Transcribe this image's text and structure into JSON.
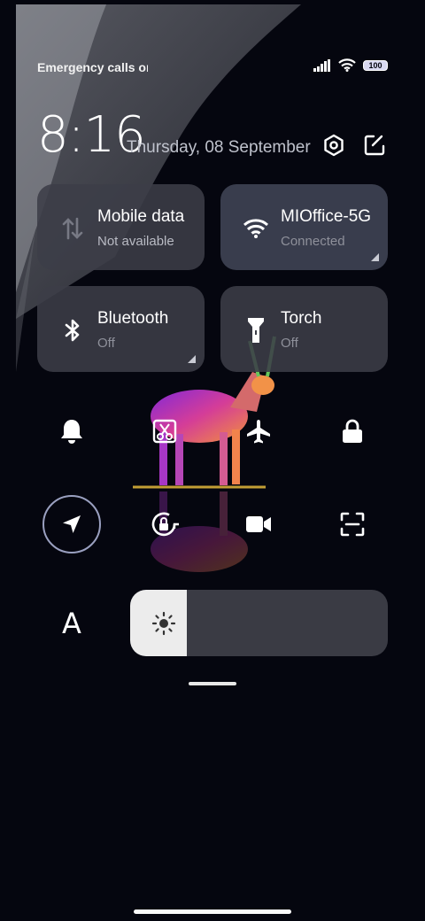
{
  "status_bar": {
    "carrier_text": "Emergency calls only",
    "battery_level": "100",
    "icons": [
      "signal-icon",
      "wifi-icon",
      "battery-icon"
    ]
  },
  "lock_info": {
    "time": "8:16",
    "date": "Thursday, 08 September"
  },
  "header_icons": [
    "settings-icon",
    "edit-icon"
  ],
  "tiles": {
    "mobile_data": {
      "label": "Mobile data",
      "status": "Not available",
      "icon": "mobile-data-icon"
    },
    "wifi": {
      "label": "MIOffice-5G",
      "status": "Connected",
      "icon": "wifi-icon"
    },
    "bluetooth": {
      "label": "Bluetooth",
      "status": "Off",
      "icon": "bluetooth-icon"
    },
    "torch": {
      "label": "Torch",
      "status": "Off",
      "icon": "torch-icon"
    }
  },
  "toggles_row1": [
    "bell-icon",
    "screenshot-icon",
    "airplane-icon",
    "lock-icon"
  ],
  "toggles_row2": [
    "location-icon",
    "rotation-lock-icon",
    "video-camera-icon",
    "scan-icon"
  ],
  "auto_brightness_label": "A",
  "brightness": {
    "level": 0.22,
    "icon": "sun-icon"
  },
  "colors": {
    "background": "#05060f",
    "tile": "#3c3e48",
    "text_dim": "#8e909a",
    "ring": "#9aa0c0"
  }
}
